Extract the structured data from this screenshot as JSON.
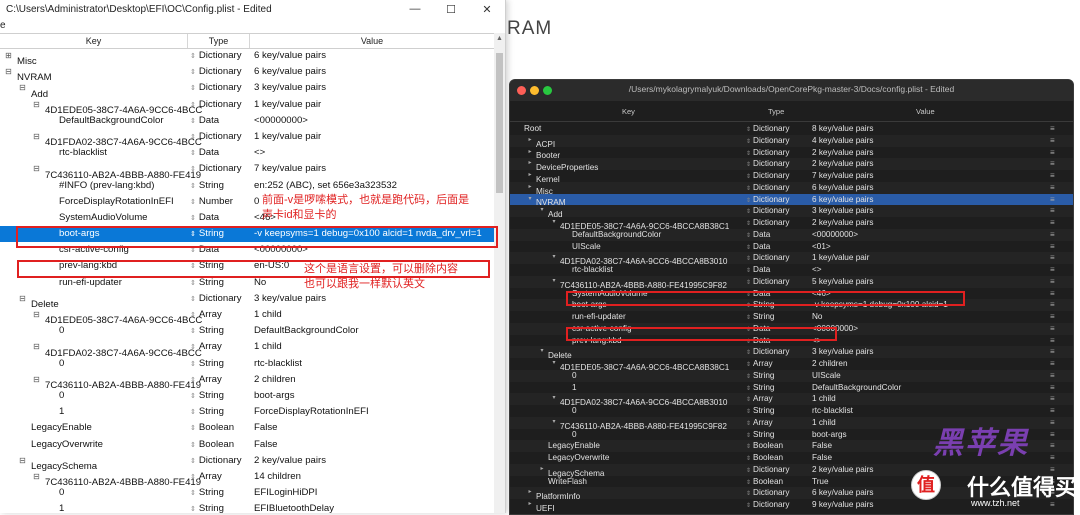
{
  "left_window": {
    "title": "C:\\Users\\Administrator\\Desktop\\EFI\\OC\\Config.plist - Edited",
    "menu_file": "e",
    "col_key": "Key",
    "col_type": "Type",
    "col_value": "Value",
    "rows": [
      {
        "indent": 0,
        "tw": "⊞",
        "key": "Misc",
        "type": "Dictionary",
        "value": "6 key/value pairs"
      },
      {
        "indent": 0,
        "tw": "⊟",
        "key": "NVRAM",
        "type": "Dictionary",
        "value": "6 key/value pairs"
      },
      {
        "indent": 1,
        "tw": "⊟",
        "key": "Add",
        "type": "Dictionary",
        "value": "3 key/value pairs"
      },
      {
        "indent": 2,
        "tw": "⊟",
        "key": "4D1EDE05-38C7-4A6A-9CC6-4BCC",
        "type": "Dictionary",
        "value": "1 key/value pair"
      },
      {
        "indent": 3,
        "tw": "",
        "key": "DefaultBackgroundColor",
        "type": "Data",
        "value": "<00000000>"
      },
      {
        "indent": 2,
        "tw": "⊟",
        "key": "4D1FDA02-38C7-4A6A-9CC6-4BCC",
        "type": "Dictionary",
        "value": "1 key/value pair"
      },
      {
        "indent": 3,
        "tw": "",
        "key": "rtc-blacklist",
        "type": "Data",
        "value": "<>"
      },
      {
        "indent": 2,
        "tw": "⊟",
        "key": "7C436110-AB2A-4BBB-A880-FE419",
        "type": "Dictionary",
        "value": "7 key/value pairs"
      },
      {
        "indent": 3,
        "tw": "",
        "key": "#INFO (prev-lang:kbd)",
        "type": "String",
        "value": "en:252 (ABC), set 656e3a323532"
      },
      {
        "indent": 3,
        "tw": "",
        "key": "ForceDisplayRotationInEFI",
        "type": "Number",
        "value": "0"
      },
      {
        "indent": 3,
        "tw": "",
        "key": "SystemAudioVolume",
        "type": "Data",
        "value": "<46>"
      },
      {
        "indent": 3,
        "tw": "",
        "key": "boot-args",
        "type": "String",
        "value": "-v keepsyms=1 debug=0x100 alcid=1 nvda_drv_vrl=1",
        "sel": true
      },
      {
        "indent": 3,
        "tw": "",
        "key": "csr-active-config",
        "type": "Data",
        "value": "<00000000>"
      },
      {
        "indent": 3,
        "tw": "",
        "key": "prev-lang:kbd",
        "type": "String",
        "value": "en-US:0"
      },
      {
        "indent": 3,
        "tw": "",
        "key": "run-efi-updater",
        "type": "String",
        "value": "No"
      },
      {
        "indent": 1,
        "tw": "⊟",
        "key": "Delete",
        "type": "Dictionary",
        "value": "3 key/value pairs"
      },
      {
        "indent": 2,
        "tw": "⊟",
        "key": "4D1EDE05-38C7-4A6A-9CC6-4BCC",
        "type": "Array",
        "value": "1 child"
      },
      {
        "indent": 3,
        "tw": "",
        "key": "0",
        "type": "String",
        "value": "DefaultBackgroundColor"
      },
      {
        "indent": 2,
        "tw": "⊟",
        "key": "4D1FDA02-38C7-4A6A-9CC6-4BCC",
        "type": "Array",
        "value": "1 child"
      },
      {
        "indent": 3,
        "tw": "",
        "key": "0",
        "type": "String",
        "value": "rtc-blacklist"
      },
      {
        "indent": 2,
        "tw": "⊟",
        "key": "7C436110-AB2A-4BBB-A880-FE419",
        "type": "Array",
        "value": "2 children"
      },
      {
        "indent": 3,
        "tw": "",
        "key": "0",
        "type": "String",
        "value": "boot-args"
      },
      {
        "indent": 3,
        "tw": "",
        "key": "1",
        "type": "String",
        "value": "ForceDisplayRotationInEFI"
      },
      {
        "indent": 1,
        "tw": "",
        "key": "LegacyEnable",
        "type": "Boolean",
        "value": "False"
      },
      {
        "indent": 1,
        "tw": "",
        "key": "LegacyOverwrite",
        "type": "Boolean",
        "value": "False"
      },
      {
        "indent": 1,
        "tw": "⊟",
        "key": "LegacySchema",
        "type": "Dictionary",
        "value": "2 key/value pairs"
      },
      {
        "indent": 2,
        "tw": "⊟",
        "key": "7C436110-AB2A-4BBB-A880-FE419",
        "type": "Array",
        "value": "14 children"
      },
      {
        "indent": 3,
        "tw": "",
        "key": "0",
        "type": "String",
        "value": "EFILoginHiDPI"
      },
      {
        "indent": 3,
        "tw": "",
        "key": "1",
        "type": "String",
        "value": "EFIBluetoothDelay"
      }
    ]
  },
  "annotations": {
    "note1_line1": "前面-v是啰嗦模式，也就是跑代码，后面是",
    "note1_line2": "声卡id和显卡的",
    "note2_line1": "这个是语言设置，可以删除内容",
    "note2_line2": "也可以跟我一样默认英文"
  },
  "background_heading": "RAM",
  "right_window": {
    "title": "/Users/mykolagrymalyuk/Downloads/OpenCorePkg-master-3/Docs/config.plist - Edited",
    "col_key": "Key",
    "col_type": "Type",
    "col_value": "Value",
    "rows": [
      {
        "indent": 0,
        "tw": "",
        "key": "Root",
        "type": "Dictionary",
        "value": "8 key/value pairs"
      },
      {
        "indent": 1,
        "tw": "▸",
        "key": "ACPI",
        "type": "Dictionary",
        "value": "4 key/value pairs"
      },
      {
        "indent": 1,
        "tw": "▸",
        "key": "Booter",
        "type": "Dictionary",
        "value": "2 key/value pairs"
      },
      {
        "indent": 1,
        "tw": "▸",
        "key": "DeviceProperties",
        "type": "Dictionary",
        "value": "2 key/value pairs"
      },
      {
        "indent": 1,
        "tw": "▸",
        "key": "Kernel",
        "type": "Dictionary",
        "value": "7 key/value pairs"
      },
      {
        "indent": 1,
        "tw": "▸",
        "key": "Misc",
        "type": "Dictionary",
        "value": "6 key/value pairs"
      },
      {
        "indent": 1,
        "tw": "▾",
        "key": "NVRAM",
        "type": "Dictionary",
        "value": "6 key/value pairs",
        "sel": true
      },
      {
        "indent": 2,
        "tw": "▾",
        "key": "Add",
        "type": "Dictionary",
        "value": "3 key/value pairs"
      },
      {
        "indent": 3,
        "tw": "▾",
        "key": "4D1EDE05-38C7-4A6A-9CC6-4BCCA8B38C1",
        "type": "Dictionary",
        "value": "2 key/value pairs"
      },
      {
        "indent": 4,
        "tw": "",
        "key": "DefaultBackgroundColor",
        "type": "Data",
        "value": "<00000000>"
      },
      {
        "indent": 4,
        "tw": "",
        "key": "UIScale",
        "type": "Data",
        "value": "<01>"
      },
      {
        "indent": 3,
        "tw": "▾",
        "key": "4D1FDA02-38C7-4A6A-9CC6-4BCCA8B3010",
        "type": "Dictionary",
        "value": "1 key/value pair"
      },
      {
        "indent": 4,
        "tw": "",
        "key": "rtc-blacklist",
        "type": "Data",
        "value": "<>"
      },
      {
        "indent": 3,
        "tw": "▾",
        "key": "7C436110-AB2A-4BBB-A880-FE41995C9F82",
        "type": "Dictionary",
        "value": "5 key/value pairs"
      },
      {
        "indent": 4,
        "tw": "",
        "key": "SystemAudioVolume",
        "type": "Data",
        "value": "<46>"
      },
      {
        "indent": 4,
        "tw": "",
        "key": "boot-args",
        "type": "String",
        "value": "-v keepsyms=1 debug=0x100 alcid=1"
      },
      {
        "indent": 4,
        "tw": "",
        "key": "run-efi-updater",
        "type": "String",
        "value": "No"
      },
      {
        "indent": 4,
        "tw": "",
        "key": "csr-active-config",
        "type": "Data",
        "value": "<00000000>"
      },
      {
        "indent": 4,
        "tw": "",
        "key": "prev-lang:kbd",
        "type": "Data",
        "value": "<>"
      },
      {
        "indent": 2,
        "tw": "▾",
        "key": "Delete",
        "type": "Dictionary",
        "value": "3 key/value pairs"
      },
      {
        "indent": 3,
        "tw": "▾",
        "key": "4D1EDE05-38C7-4A6A-9CC6-4BCCA8B38C1",
        "type": "Array",
        "value": "2 children"
      },
      {
        "indent": 4,
        "tw": "",
        "key": "0",
        "type": "String",
        "value": "UIScale"
      },
      {
        "indent": 4,
        "tw": "",
        "key": "1",
        "type": "String",
        "value": "DefaultBackgroundColor"
      },
      {
        "indent": 3,
        "tw": "▾",
        "key": "4D1FDA02-38C7-4A6A-9CC6-4BCCA8B3010",
        "type": "Array",
        "value": "1 child"
      },
      {
        "indent": 4,
        "tw": "",
        "key": "0",
        "type": "String",
        "value": "rtc-blacklist"
      },
      {
        "indent": 3,
        "tw": "▾",
        "key": "7C436110-AB2A-4BBB-A880-FE41995C9F82",
        "type": "Array",
        "value": "1 child"
      },
      {
        "indent": 4,
        "tw": "",
        "key": "0",
        "type": "String",
        "value": "boot-args"
      },
      {
        "indent": 2,
        "tw": "",
        "key": "LegacyEnable",
        "type": "Boolean",
        "value": "False"
      },
      {
        "indent": 2,
        "tw": "",
        "key": "LegacyOverwrite",
        "type": "Boolean",
        "value": "False"
      },
      {
        "indent": 2,
        "tw": "▸",
        "key": "LegacySchema",
        "type": "Dictionary",
        "value": "2 key/value pairs"
      },
      {
        "indent": 2,
        "tw": "",
        "key": "WriteFlash",
        "type": "Boolean",
        "value": "True"
      },
      {
        "indent": 1,
        "tw": "▸",
        "key": "PlatformInfo",
        "type": "Dictionary",
        "value": "6 key/value pairs"
      },
      {
        "indent": 1,
        "tw": "▸",
        "key": "UEFI",
        "type": "Dictionary",
        "value": "9 key/value pairs"
      }
    ]
  },
  "watermark": {
    "logo_text": "黑苹果",
    "badge": "值",
    "site_text": "什么值得买",
    "url_text": "www.tzh.net"
  },
  "colors": {
    "win_selection": "#0a78d7",
    "mac_selection": "#2a5ca8",
    "annotation_red": "#e02020"
  }
}
